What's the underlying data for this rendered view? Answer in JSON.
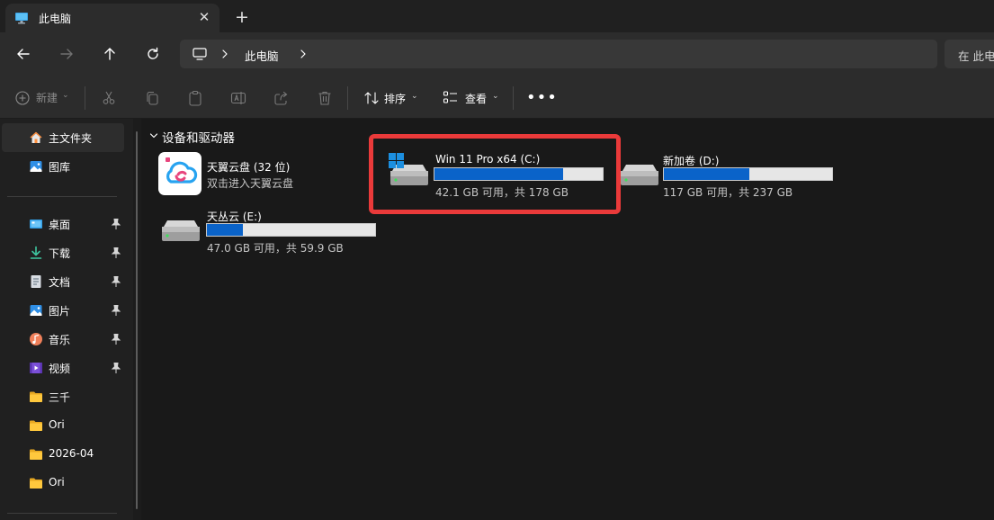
{
  "window": {
    "tab_title": "此电脑",
    "tab_icon": "monitor-icon",
    "close_glyph": "✕",
    "new_tab_glyph": "+"
  },
  "address_bar": {
    "breadcrumb": "此电脑",
    "search_placeholder": "在 此电"
  },
  "toolbar": {
    "new_label": "新建",
    "sort_label": "排序",
    "view_label": "查看",
    "more_glyph": "•••",
    "chevron": "⌄"
  },
  "sidebar": {
    "items": [
      {
        "label": "主文件夹",
        "icon": "home-icon",
        "selected": true
      },
      {
        "label": "图库",
        "icon": "gallery-icon"
      }
    ],
    "pinned": [
      {
        "label": "桌面",
        "icon": "desktop-icon",
        "pinned": true
      },
      {
        "label": "下载",
        "icon": "download-icon",
        "pinned": true
      },
      {
        "label": "文档",
        "icon": "document-icon",
        "pinned": true
      },
      {
        "label": "图片",
        "icon": "picture-icon",
        "pinned": true
      },
      {
        "label": "音乐",
        "icon": "music-icon",
        "pinned": true
      },
      {
        "label": "视频",
        "icon": "video-icon",
        "pinned": true
      },
      {
        "label": "三千",
        "icon": "folder-icon"
      },
      {
        "label": "Ori",
        "icon": "folder-icon"
      },
      {
        "label": "2026-04",
        "icon": "folder-icon"
      },
      {
        "label": "Ori",
        "icon": "folder-icon"
      }
    ]
  },
  "content": {
    "group_title": "设备和驱动器",
    "cloud": {
      "name": "天翼云盘 (32 位)",
      "subtitle": "双击进入天翼云盘"
    },
    "drives": [
      {
        "name": "Win 11 Pro x64 (C:)",
        "space": "42.1 GB 可用，共 178 GB",
        "used_fraction": 0.764,
        "highlighted": true,
        "system": true
      },
      {
        "name": "新加卷 (D:)",
        "space": "117 GB 可用，共 237 GB",
        "used_fraction": 0.506
      },
      {
        "name": "天丛云 (E:)",
        "space": "47.0 GB 可用，共 59.9 GB",
        "used_fraction": 0.215
      }
    ]
  },
  "colors": {
    "accent": "#0a63c9",
    "highlight": "#ea3a3a",
    "background": "#191919",
    "sidebar": "#202020"
  }
}
